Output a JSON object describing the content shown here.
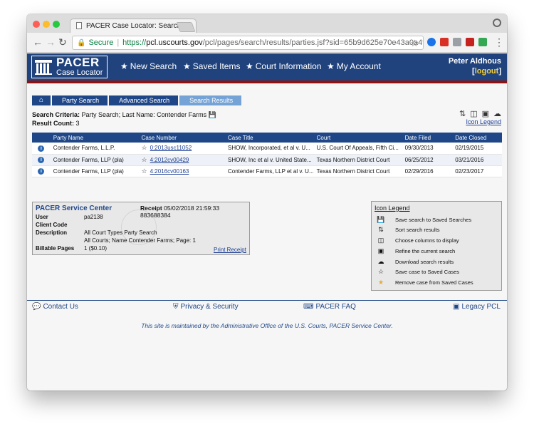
{
  "browser": {
    "tab_title": "PACER Case Locator: Search R",
    "tab_close": "×",
    "nav": {
      "back": "←",
      "forward": "→",
      "reload": "↻"
    },
    "address": {
      "secure_label": "Secure",
      "scheme": "https://",
      "host": "pcl.uscourts.gov",
      "path": "/pcl/pages/search/results/parties.jsf?sid=65b9d625e70e43a0a4f2..."
    },
    "menu": "⋮"
  },
  "header": {
    "logo_line1": "PACER",
    "logo_line2": "Case Locator",
    "nav": [
      {
        "icon": "★",
        "label": "New Search"
      },
      {
        "icon": "★",
        "label": "Saved Items"
      },
      {
        "icon": "★",
        "label": "Court Information"
      },
      {
        "icon": "★",
        "label": "My Account"
      }
    ],
    "user_name": "Peter Aldhous",
    "logout_open": "[",
    "logout_label": "logout",
    "logout_close": "]"
  },
  "breadcrumb": {
    "home": "⌂",
    "items": [
      "Party Search",
      "Advanced Search",
      "Search Results"
    ]
  },
  "criteria": {
    "label": "Search Criteria:",
    "value": "Party Search; Last Name: Contender Farms",
    "count_label": "Result Count:",
    "count_value": "3",
    "icon_legend_link": "Icon Legend"
  },
  "table": {
    "headers": [
      "Party Name",
      "Case Number",
      "Case Title",
      "Court",
      "Date Filed",
      "Date Closed"
    ],
    "rows": [
      {
        "party": "Contender Farms, L.L.P.",
        "case_number": "0:2013usc11052",
        "case_title": "SHOW, Incorporated, et al v. U...",
        "court": "U.S. Court Of Appeals, Fifth Ci...",
        "date_filed": "09/30/2013",
        "date_closed": "02/19/2015"
      },
      {
        "party": "Contender Farms, LLP (pla)",
        "case_number": "4:2012cv00429",
        "case_title": "SHOW, Inc et al v. United State...",
        "court": "Texas Northern District Court",
        "date_filed": "06/25/2012",
        "date_closed": "03/21/2016"
      },
      {
        "party": "Contender Farms, LLP (pla)",
        "case_number": "4:2016cv00163",
        "case_title": "Contender Farms, LLP et al v. U...",
        "court": "Texas Northern District Court",
        "date_filed": "02/29/2016",
        "date_closed": "02/23/2017"
      }
    ]
  },
  "receipt": {
    "title": "PACER Service Center",
    "receipt_label": "Receipt",
    "receipt_value": "05/02/2018 21:59:33 883688384",
    "user_label": "User",
    "user_value": "pa2138",
    "client_label": "Client Code",
    "client_value": "",
    "description_label": "Description",
    "description_line1": "All Court Types Party Search",
    "description_line2": "All Courts; Name Contender Farms; Page: 1",
    "billable_label": "Billable Pages",
    "billable_value": "1 ($0.10)",
    "print_label": "Print Receipt"
  },
  "legend": {
    "title": "Icon Legend",
    "items": [
      {
        "icon": "save-icon",
        "label": "Save search to Saved Searches"
      },
      {
        "icon": "sort-icon",
        "label": "Sort search results"
      },
      {
        "icon": "columns-icon",
        "label": "Choose columns to display"
      },
      {
        "icon": "refine-icon",
        "label": "Refine the current search"
      },
      {
        "icon": "download-icon",
        "label": "Download search results"
      },
      {
        "icon": "star-outline-icon",
        "label": "Save case to Saved Cases"
      },
      {
        "icon": "star-filled-icon",
        "label": "Remove case from Saved Cases"
      }
    ]
  },
  "footer": {
    "contact": "Contact Us",
    "privacy": "Privacy & Security",
    "faq": "PACER FAQ",
    "legacy": "Legacy PCL",
    "maintained": "This site is maintained by the Administrative Office of the U.S. Courts, PACER Service Center."
  },
  "colors": {
    "brand_blue": "#20437e",
    "accent_red": "#8e1212",
    "logout_yellow": "#f4d03f",
    "link_blue": "#1c3f94"
  }
}
